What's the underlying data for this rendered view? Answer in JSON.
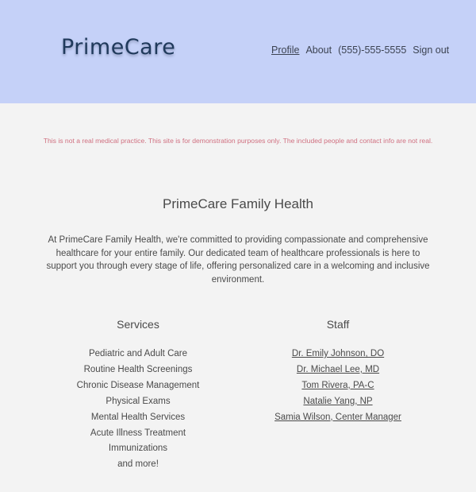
{
  "header": {
    "logo": "PrimeCare",
    "nav": {
      "profile": "Profile",
      "about": "About",
      "phone": "(555)-555-5555",
      "sign_out": "Sign out"
    }
  },
  "disclaimer": "This is not a real medical practice. This site is for demonstration purposes only. The included people and contact info are not real.",
  "main": {
    "title": "PrimeCare Family Health",
    "intro": "At PrimeCare Family Health, we're committed to providing compassionate and comprehensive healthcare for your entire family. Our dedicated team of healthcare professionals is here to support you through every stage of life, offering personalized care in a welcoming and inclusive environment."
  },
  "services": {
    "heading": "Services",
    "items": [
      "Pediatric and Adult Care",
      "Routine Health Screenings",
      "Chronic Disease Management",
      "Physical Exams",
      "Mental Health Services",
      "Acute Illness Treatment",
      "Immunizations",
      "and more!"
    ]
  },
  "staff": {
    "heading": "Staff",
    "items": [
      "Dr. Emily Johnson, DO",
      "Dr. Michael Lee, MD",
      "Tom Rivera, PA-C",
      "Natalie Yang, NP",
      "Samia Wilson, Center Manager"
    ]
  },
  "colors": {
    "header_bg": "#c5d1f8",
    "page_bg": "#f3f3f3",
    "logo": "#203a5c",
    "disclaimer": "#d07080"
  }
}
